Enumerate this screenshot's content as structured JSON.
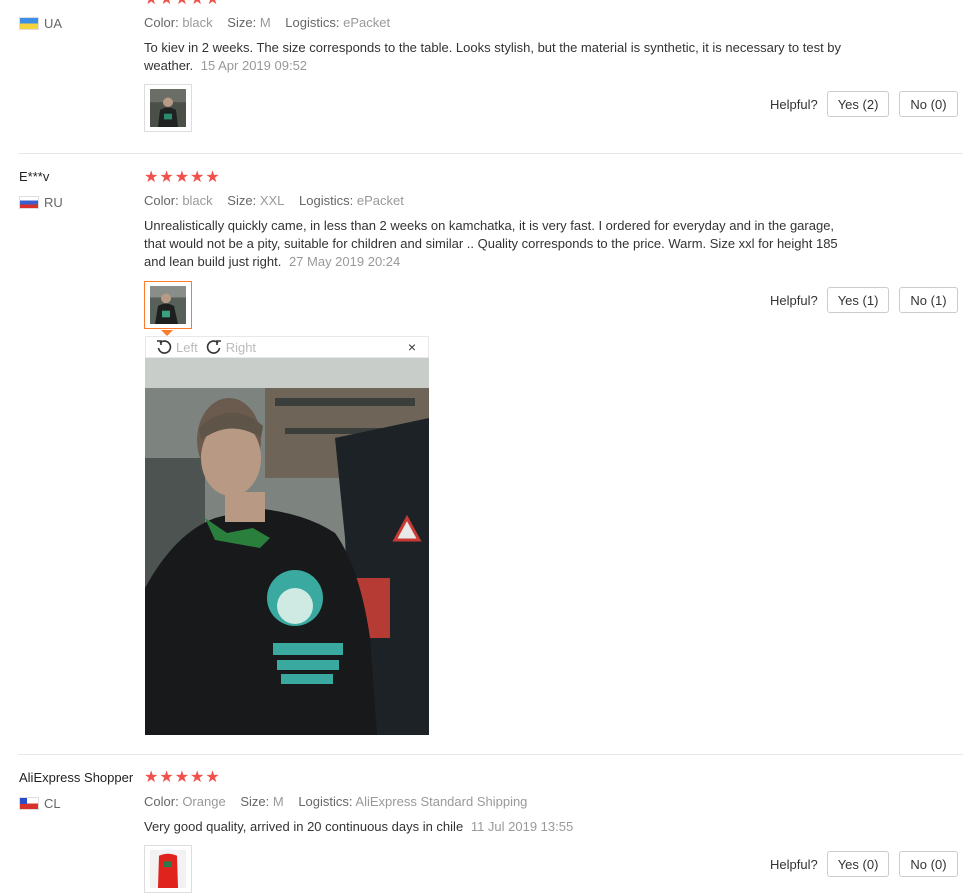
{
  "reviews": [
    {
      "name": "",
      "country": "UA",
      "attrs": {
        "color_label": "Color:",
        "color": "black",
        "size_label": "Size:",
        "size": "M",
        "logistics_label": "Logistics:",
        "logistics": "ePacket"
      },
      "text": "To kiev in 2 weeks. The size corresponds to the table. Looks stylish, but the material is synthetic, it is necessary to test by weather.",
      "time": "15 Apr 2019 09:52",
      "rating": 5,
      "helpful_label": "Helpful?",
      "yes_label": "Yes (2)",
      "no_label": "No (0)"
    },
    {
      "name": "E***v",
      "country": "RU",
      "attrs": {
        "color_label": "Color:",
        "color": "black",
        "size_label": "Size:",
        "size": "XXL",
        "logistics_label": "Logistics:",
        "logistics": "ePacket"
      },
      "text": "Unrealistically quickly came, in less than 2 weeks on kamchatka, it is very fast. I ordered for everyday and in the garage, that would not be a pity, suitable for children and similar .. Quality corresponds to the price. Warm. Size xxl for height 185 and lean build just right.",
      "time": "27 May 2019 20:24",
      "rating": 5,
      "helpful_label": "Helpful?",
      "yes_label": "Yes (1)",
      "no_label": "No (1)"
    },
    {
      "name": "AliExpress Shopper",
      "country": "CL",
      "attrs": {
        "color_label": "Color:",
        "color": "Orange",
        "size_label": "Size:",
        "size": "M",
        "logistics_label": "Logistics:",
        "logistics": "AliExpress Standard Shipping"
      },
      "text": "Very good quality, arrived in 20 continuous days in chile",
      "time": "11 Jul 2019 13:55",
      "rating": 5,
      "helpful_label": "Helpful?",
      "yes_label": "Yes (0)",
      "no_label": "No (0)"
    }
  ],
  "viewer": {
    "left_label": "Left",
    "right_label": "Right",
    "close_label": "×"
  },
  "stars_glyph": "★★★★★",
  "colors": {
    "star": "#f0514a",
    "active_thumb": "#ff7b2c"
  }
}
